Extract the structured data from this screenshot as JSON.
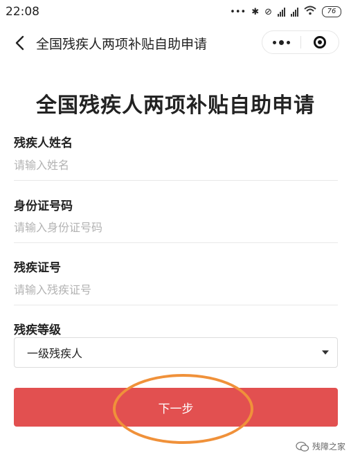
{
  "status_bar": {
    "time": "22:08",
    "icons": [
      "more-dots-icon",
      "bluetooth-icon",
      "alarm-off-icon",
      "signal-icon",
      "signal-icon",
      "wifi-icon",
      "battery-icon"
    ],
    "battery": "76"
  },
  "nav": {
    "title": "全国残疾人两项补贴自助申请"
  },
  "page": {
    "title": "全国残疾人两项补贴自助申请"
  },
  "form": {
    "name": {
      "label": "残疾人姓名",
      "placeholder": "请输入姓名",
      "value": ""
    },
    "id_number": {
      "label": "身份证号码",
      "placeholder": "请输入身份证号码",
      "value": ""
    },
    "disability_cert": {
      "label": "残疾证号",
      "placeholder": "请输入残疾证号",
      "value": ""
    },
    "disability_level": {
      "label": "残疾等级",
      "selected": "一级残疾人"
    }
  },
  "button": {
    "next_label": "下一步"
  },
  "watermark": {
    "text": "残障之家"
  },
  "colors": {
    "button": "#e25050",
    "highlight_ring": "#f0913a"
  }
}
